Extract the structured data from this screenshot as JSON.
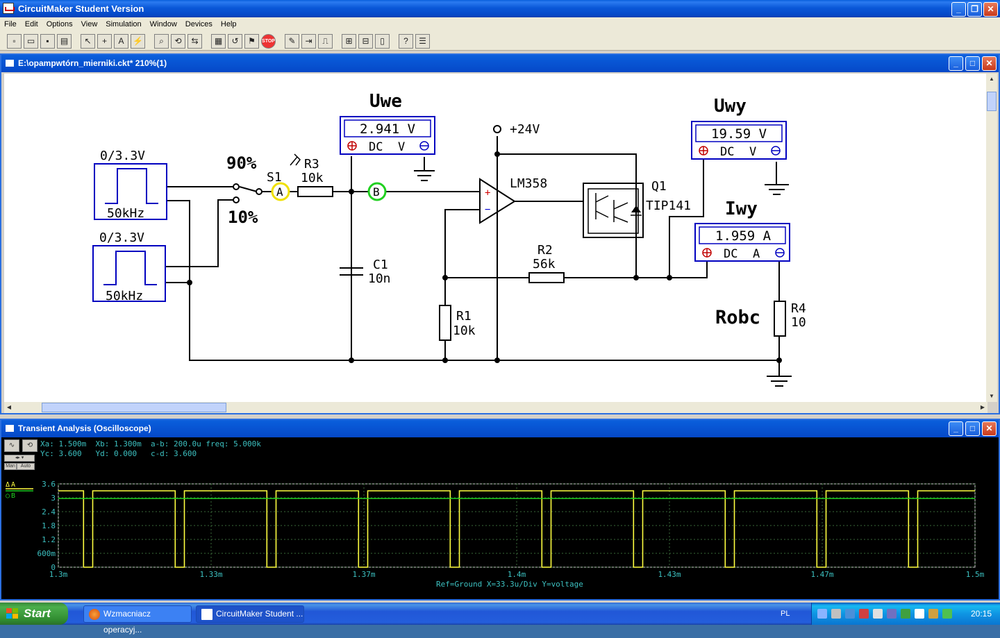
{
  "app": {
    "title": "CircuitMaker Student Version"
  },
  "menu": [
    "File",
    "Edit",
    "Options",
    "View",
    "Simulation",
    "Window",
    "Devices",
    "Help"
  ],
  "circuit_window": {
    "title": "E:\\opampwtórn_mierniki.ckt* 210%(1)"
  },
  "circuit": {
    "sources": [
      {
        "label": "0/3.3V",
        "freq": "50kHz"
      },
      {
        "label": "0/3.3V",
        "freq": "50kHz"
      }
    ],
    "switch": {
      "name": "S1",
      "top": "90%",
      "bottom": "10%"
    },
    "probes": {
      "a": "A",
      "b": "B"
    },
    "r3": {
      "name": "R3",
      "value": "10k"
    },
    "c1": {
      "name": "C1",
      "value": "10n"
    },
    "r1": {
      "name": "R1",
      "value": "10k"
    },
    "r2": {
      "name": "R2",
      "value": "56k"
    },
    "r4": {
      "name": "R4",
      "value": "10"
    },
    "opamp": {
      "name": "LM358",
      "plus": "+",
      "minus": "−"
    },
    "supply": "+24V",
    "q1": {
      "name": "Q1",
      "part": "TIP141"
    },
    "meters": {
      "uwe": {
        "title": "Uwe",
        "value": "2.941 V",
        "mode": "DC",
        "unit": "V"
      },
      "uwy": {
        "title": "Uwy",
        "value": "19.59 V",
        "mode": "DC",
        "unit": "V"
      },
      "iwy": {
        "title": "Iwy",
        "value": "1.959 A",
        "mode": "DC",
        "unit": "A"
      }
    },
    "robc_label": "Robc"
  },
  "scope_window": {
    "title": "Transient Analysis (Oscilloscope)",
    "readout_line1": "Xa: 1.500m  Xb: 1.300m  a-b: 200.0u freq: 5.000k",
    "readout_line2": "Yc: 3.600   Yd: 0.000   c-d: 3.600",
    "footer": "Ref=Ground  X=33.3u/Div Y=voltage",
    "mode_man": "Man",
    "mode_auto": "Auto",
    "legend_a": "A",
    "legend_b": "B",
    "colors": {
      "trace_a": "#ffff40",
      "trace_b": "#20d020",
      "grid": "#3a6a3a",
      "text": "#3cc0c0"
    }
  },
  "chart_data": {
    "type": "line",
    "xlabel": "",
    "ylabel": "",
    "x_ticks": [
      "1.3m",
      "1.33m",
      "1.37m",
      "1.4m",
      "1.43m",
      "1.47m",
      "1.5m"
    ],
    "y_ticks": [
      "3.6",
      "3",
      "2.4",
      "1.8",
      "1.2",
      "600m",
      "0"
    ],
    "xlim": [
      1.3,
      1.5
    ],
    "ylim": [
      0,
      3.6
    ],
    "period_ms": 0.02,
    "duty_high": 0.9,
    "series": [
      {
        "name": "A",
        "high": 3.3,
        "low": 0.0
      },
      {
        "name": "B",
        "level": 2.97
      }
    ]
  },
  "taskbar": {
    "start": "Start",
    "tasks": [
      "Wzmacniacz operacyj...",
      "CircuitMaker Student ..."
    ],
    "lang": "PL",
    "clock": "20:15"
  }
}
